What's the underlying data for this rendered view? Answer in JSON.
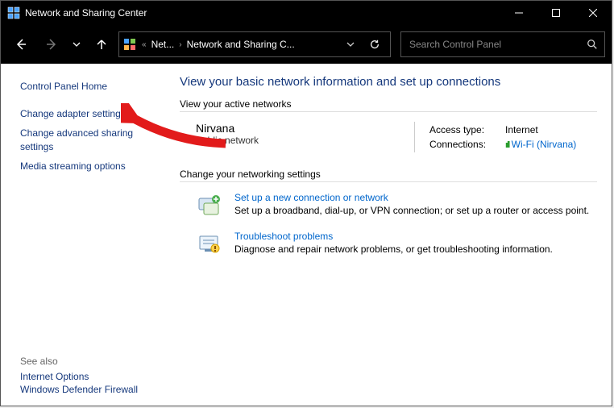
{
  "window": {
    "title": "Network and Sharing Center"
  },
  "toolbar": {
    "breadcrumb": {
      "prefix": "«",
      "item1": "Net...",
      "item2": "Network and Sharing C..."
    },
    "search_placeholder": "Search Control Panel"
  },
  "sidebar": {
    "home": "Control Panel Home",
    "links": {
      "adapter": "Change adapter settings",
      "advanced": "Change advanced sharing settings",
      "media": "Media streaming options"
    },
    "see_also_label": "See also",
    "see_also": {
      "internet": "Internet Options",
      "firewall": "Windows Defender Firewall"
    }
  },
  "main": {
    "heading": "View your basic network information and set up connections",
    "active_label": "View your active networks",
    "network": {
      "name": "Nirvana",
      "type": "Public network",
      "access_label": "Access type:",
      "access_value": "Internet",
      "conn_label": "Connections:",
      "conn_link": "Wi-Fi (Nirvana)"
    },
    "change_label": "Change your networking settings",
    "setup": {
      "title": "Set up a new connection or network",
      "desc": "Set up a broadband, dial-up, or VPN connection; or set up a router or access point."
    },
    "trouble": {
      "title": "Troubleshoot problems",
      "desc": "Diagnose and repair network problems, or get troubleshooting information."
    }
  }
}
